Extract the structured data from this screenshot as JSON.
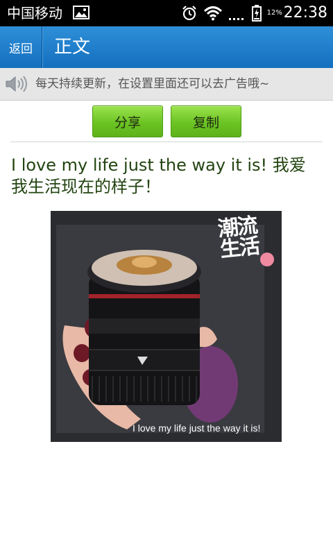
{
  "status_bar": {
    "carrier": "中国移动",
    "battery_text": "12%",
    "time": "22:38"
  },
  "title_bar": {
    "back_label": "返回",
    "title": "正文"
  },
  "notice": {
    "text": "每天持续更新，在设置里面还可以去广告哦~"
  },
  "actions": {
    "share_label": "分享",
    "copy_label": "复制"
  },
  "article": {
    "text": "I love my life just the way it is! 我爱我生活现在的样子！",
    "image": {
      "caption": "I love my life just the way it is!",
      "watermark_text": "潮流生活"
    }
  },
  "colors": {
    "title_bar_blue": "#1a7cd0",
    "button_green": "#6cc324",
    "article_text": "#224411"
  }
}
